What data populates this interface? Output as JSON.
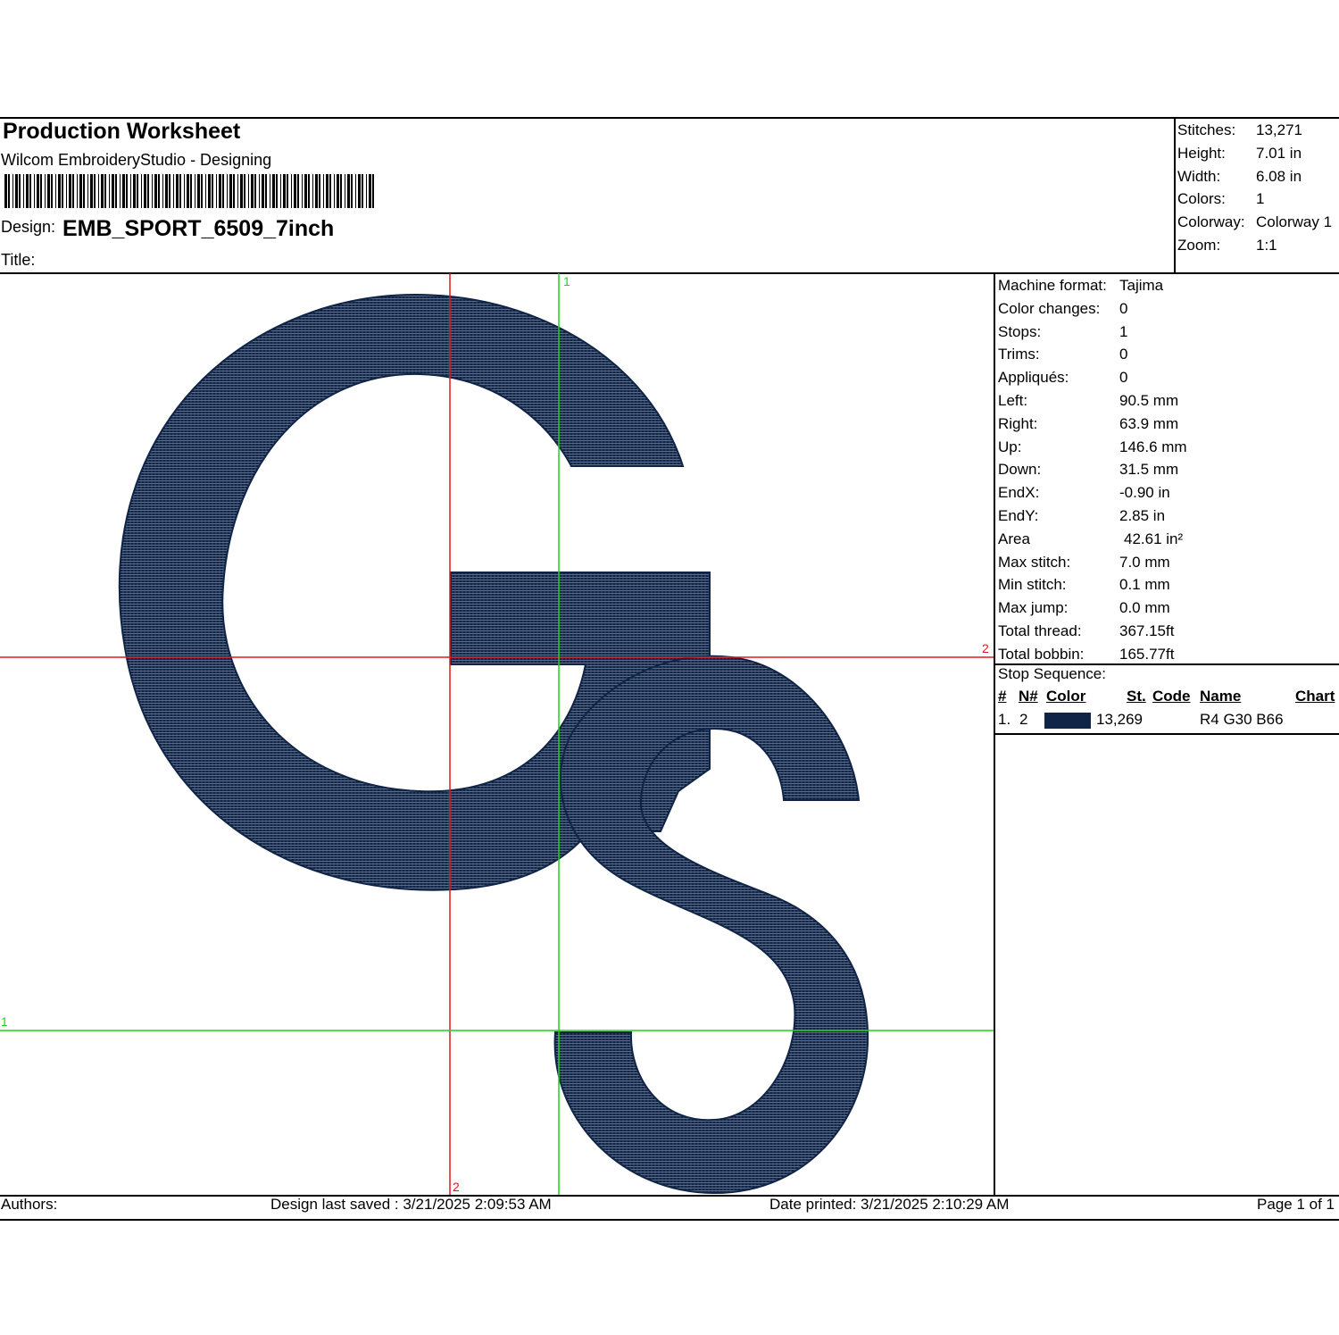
{
  "header": {
    "title": "Production Worksheet",
    "software": "Wilcom EmbroideryStudio - Designing",
    "design_label": "Design:",
    "design_name": "EMB_SPORT_6509_7inch",
    "title_label": "Title:"
  },
  "summary": [
    {
      "label": "Stitches:",
      "value": "13,271"
    },
    {
      "label": "Height:",
      "value": "7.01 in"
    },
    {
      "label": "Width:",
      "value": "6.08 in"
    },
    {
      "label": "Colors:",
      "value": "1"
    },
    {
      "label": "Colorway:",
      "value": "Colorway 1"
    },
    {
      "label": "Zoom:",
      "value": "1:1"
    }
  ],
  "details": [
    {
      "label": "Machine format:",
      "value": "Tajima"
    },
    {
      "label": "Color changes:",
      "value": "0"
    },
    {
      "label": "Stops:",
      "value": "1"
    },
    {
      "label": "Trims:",
      "value": "0"
    },
    {
      "label": "Appliqués:",
      "value": "0"
    },
    {
      "label": "Left:",
      "value": "90.5 mm"
    },
    {
      "label": "Right:",
      "value": "63.9 mm"
    },
    {
      "label": "Up:",
      "value": "146.6 mm"
    },
    {
      "label": "Down:",
      "value": "31.5 mm"
    },
    {
      "label": "EndX:",
      "value": "-0.90 in"
    },
    {
      "label": "EndY:",
      "value": "2.85 in"
    },
    {
      "label": "Area",
      "value": "42.61 in²"
    },
    {
      "label": "Max stitch:",
      "value": "7.0 mm"
    },
    {
      "label": "Min stitch:",
      "value": "0.1 mm"
    },
    {
      "label": "Max jump:",
      "value": "0.0 mm"
    },
    {
      "label": "Total thread:",
      "value": "367.15ft"
    },
    {
      "label": "Total bobbin:",
      "value": "165.77ft"
    }
  ],
  "stop_sequence": {
    "label": "Stop Sequence:",
    "headers": {
      "num": "#",
      "needle": "N#",
      "color": "Color",
      "stitches": "St.",
      "code": "Code",
      "name": "Name",
      "chart": "Chart"
    },
    "rows": [
      {
        "num": "1.",
        "needle": "2",
        "stitches": "13,269",
        "name": "R4 G30 B66",
        "swatch_color": "#0f2446"
      }
    ]
  },
  "canvas": {
    "marker_green_top": "1",
    "marker_red_right": "2",
    "marker_green_left": "1",
    "marker_red_bottom": "2",
    "thread_color": "#0f2446",
    "red_guide_color": "#e0191f",
    "green_guide_color": "#21d121"
  },
  "footer": {
    "authors": "Authors:",
    "saved": "Design last saved : 3/21/2025 2:09:53 AM",
    "printed": "Date printed: 3/21/2025 2:10:29 AM",
    "page": "Page 1 of 1"
  }
}
